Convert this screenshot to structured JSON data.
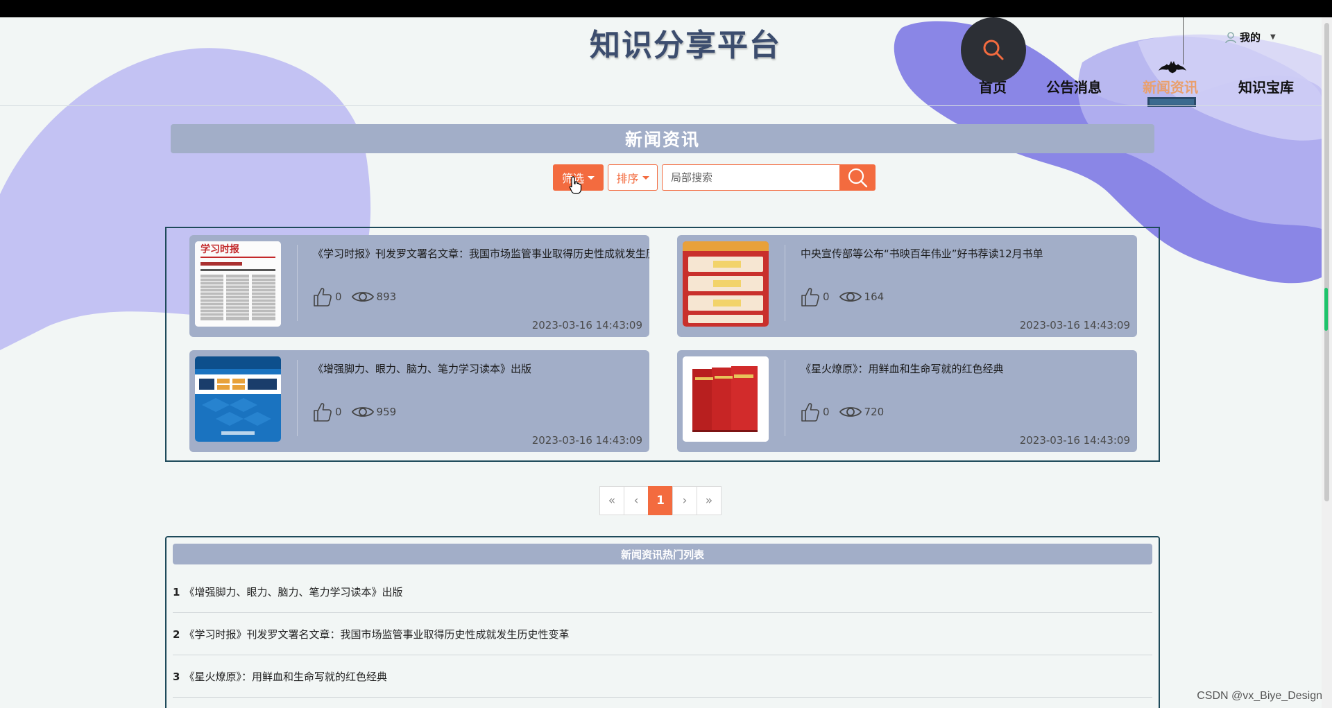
{
  "header": {
    "site_title": "知识分享平台",
    "user_label": "我的",
    "nav": [
      {
        "label": "首页"
      },
      {
        "label": "公告消息"
      },
      {
        "label": "新闻资讯",
        "active": true
      },
      {
        "label": "知识宝库"
      }
    ]
  },
  "section": {
    "title": "新闻资讯"
  },
  "controls": {
    "filter_label": "筛选",
    "sort_label": "排序",
    "search_placeholder": "局部搜索"
  },
  "news": [
    {
      "title": "《学习时报》刊发罗文署名文章：我国市场监管事业取得历史性成就发生历史性变革",
      "likes": "0",
      "views": "893",
      "date": "2023-03-16 14:43:09",
      "thumb_icon": "newspaper-thumb"
    },
    {
      "title": "中央宣传部等公布“书映百年伟业”好书荐读12月书单",
      "likes": "0",
      "views": "164",
      "date": "2023-03-16 14:43:09",
      "thumb_icon": "red-booklist-thumb"
    },
    {
      "title": "《增强脚力、眼力、脑力、笔力学习读本》出版",
      "likes": "0",
      "views": "959",
      "date": "2023-03-16 14:43:09",
      "thumb_icon": "blue-book-cover-thumb"
    },
    {
      "title": "《星火燎原》：用鲜血和生命写就的红色经典",
      "likes": "0",
      "views": "720",
      "date": "2023-03-16 14:43:09",
      "thumb_icon": "red-books-thumb"
    }
  ],
  "pagination": {
    "first": "«",
    "prev": "‹",
    "current": "1",
    "next": "›",
    "last": "»"
  },
  "hot": {
    "title": "新闻资讯热门列表",
    "items": [
      {
        "num": "1",
        "text": "《增强脚力、眼力、脑力、笔力学习读本》出版"
      },
      {
        "num": "2",
        "text": "《学习时报》刊发罗文署名文章：我国市场监管事业取得历史性成就发生历史性变革"
      },
      {
        "num": "3",
        "text": "《星火燎原》：用鲜血和生命写就的红色经典"
      }
    ]
  },
  "watermark": "CSDN @vx_Biye_Design",
  "colors": {
    "accent": "#f36b3f",
    "card_bg": "#a2aec8",
    "frame_border": "#1e4a5a",
    "blob_purple": "#8a86e6",
    "blob_lavender": "#c3c2f3"
  }
}
